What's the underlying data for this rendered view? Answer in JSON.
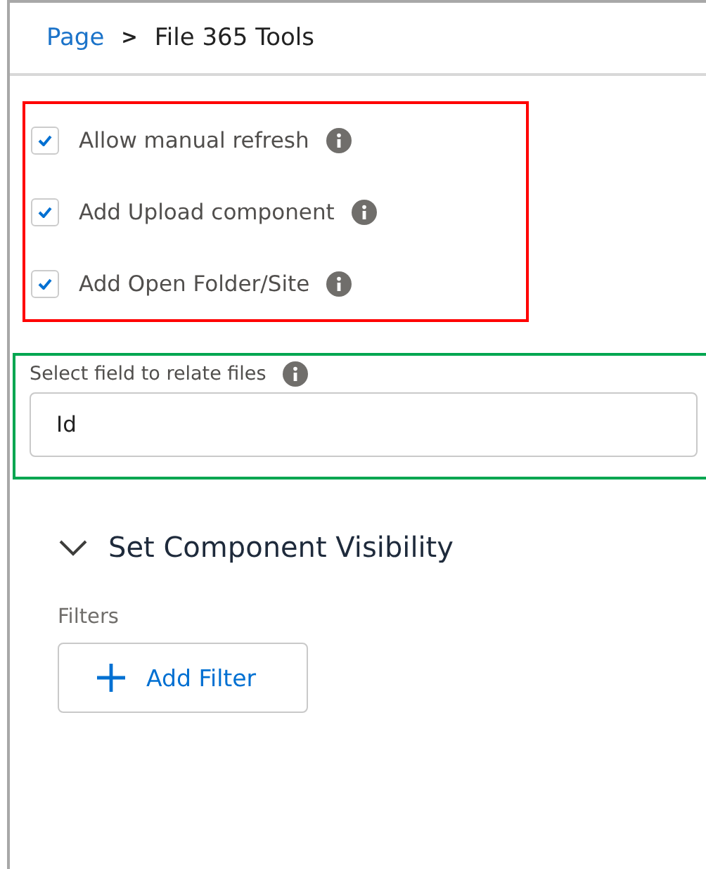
{
  "breadcrumb": {
    "parent": "Page",
    "separator": ">",
    "current": "File 365 Tools"
  },
  "options": [
    {
      "label": "Allow manual refresh",
      "checked": true
    },
    {
      "label": "Add Upload component",
      "checked": true
    },
    {
      "label": "Add Open Folder/Site",
      "checked": true
    }
  ],
  "relate_field": {
    "label": "Select field to relate files",
    "value": "Id"
  },
  "visibility_section": {
    "title": "Set Component Visibility",
    "expanded": true,
    "filters_label": "Filters",
    "add_filter_button": "Add Filter"
  }
}
